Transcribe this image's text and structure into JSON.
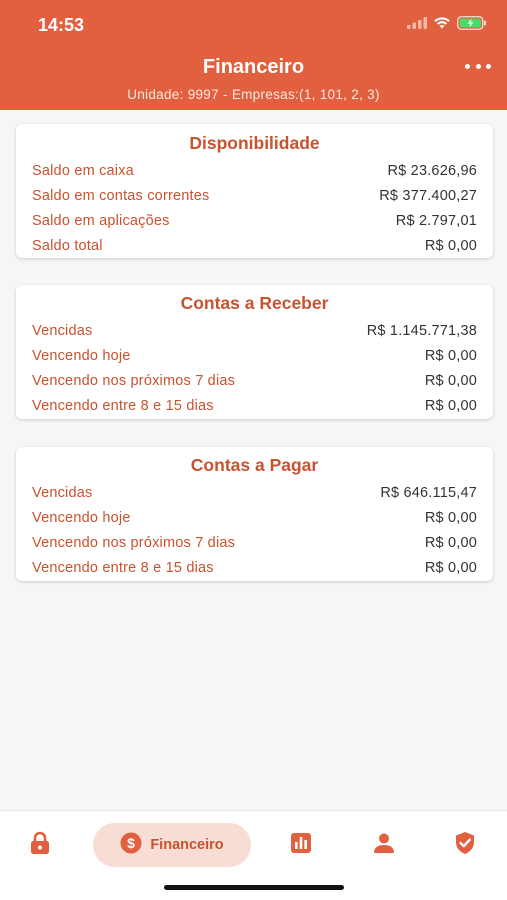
{
  "status_bar": {
    "time": "14:53"
  },
  "header": {
    "title": "Financeiro",
    "subtitle": "Unidade: 9997 - Empresas:(1, 101, 2, 3)"
  },
  "colors": {
    "accent": "#e0603f",
    "text_accent": "#c9522f",
    "tab_active_bg": "#f8ddd5"
  },
  "cards": [
    {
      "title": "Disponibilidade",
      "rows": [
        {
          "label": "Saldo em caixa",
          "value": "R$ 23.626,96"
        },
        {
          "label": "Saldo em contas correntes",
          "value": "R$ 377.400,27"
        },
        {
          "label": "Saldo em aplicações",
          "value": "R$ 2.797,01"
        },
        {
          "label": "Saldo total",
          "value": "R$ 0,00"
        }
      ]
    },
    {
      "title": "Contas a Receber",
      "rows": [
        {
          "label": "Vencidas",
          "value": "R$ 1.145.771,38"
        },
        {
          "label": "Vencendo hoje",
          "value": "R$ 0,00"
        },
        {
          "label": "Vencendo nos próximos 7 dias",
          "value": "R$ 0,00"
        },
        {
          "label": "Vencendo entre 8 e 15 dias",
          "value": "R$ 0,00"
        }
      ]
    },
    {
      "title": "Contas a Pagar",
      "rows": [
        {
          "label": "Vencidas",
          "value": "R$ 646.115,47"
        },
        {
          "label": "Vencendo hoje",
          "value": "R$ 0,00"
        },
        {
          "label": "Vencendo nos próximos 7 dias",
          "value": "R$ 0,00"
        },
        {
          "label": "Vencendo entre 8 e 15 dias",
          "value": "R$ 0,00"
        }
      ]
    }
  ],
  "tab_bar": {
    "tabs": [
      {
        "icon": "lock-icon"
      },
      {
        "icon": "dollar-circle-icon",
        "label": "Financeiro",
        "active": true
      },
      {
        "icon": "bar-chart-icon"
      },
      {
        "icon": "person-icon"
      },
      {
        "icon": "shield-check-icon"
      }
    ]
  }
}
